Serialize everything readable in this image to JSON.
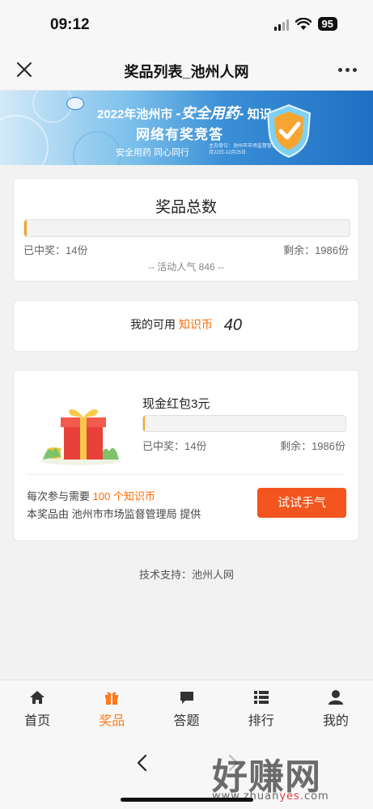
{
  "status_bar": {
    "time": "09:12",
    "battery": "95"
  },
  "nav": {
    "title": "奖品列表_池州人网"
  },
  "banner": {
    "line1_prefix": "2022年池州市",
    "line1_emph": "-安全用药-",
    "line1_suffix": "知识",
    "line2": "网络有奖竞答",
    "line3": "安全用药 同心同行",
    "line3_small": "主办单位：池州市市场监督管理局 2022年11月22日-12月25日"
  },
  "total_card": {
    "title": "奖品总数",
    "progress": 0.007,
    "won": "已中奖：14份",
    "remaining": "剩余：1986份",
    "popularity": "-- 活动人气  846 --"
  },
  "coins_card": {
    "prefix": "我的可用",
    "accent": "知识币",
    "value": "40"
  },
  "prize_card": {
    "name": "现金红包3元",
    "progress": 0.007,
    "won": "已中奖：14份",
    "remaining": "剩余：1986份",
    "cost_prefix": "每次参与需要",
    "cost_accent": "100 个知识币",
    "provider": "本奖品由 池州市市场监督管理局 提供",
    "button": "试试手气"
  },
  "support": "技术支持：池州人网",
  "tabs": [
    {
      "label": "首页",
      "icon": "home-icon",
      "active": false
    },
    {
      "label": "奖品",
      "icon": "gift-icon",
      "active": true
    },
    {
      "label": "答题",
      "icon": "chat-icon",
      "active": false
    },
    {
      "label": "排行",
      "icon": "list-icon",
      "active": false
    },
    {
      "label": "我的",
      "icon": "person-icon",
      "active": false
    }
  ],
  "watermark": {
    "text": "好赚网",
    "url_prefix": "www.zhuan",
    "url_accent": "yes",
    "url_suffix": ".com"
  },
  "colors": {
    "accent": "#ff6a00",
    "button": "#f4541d",
    "progress": "#f5a623",
    "tab_active": "#ff7a1a"
  }
}
